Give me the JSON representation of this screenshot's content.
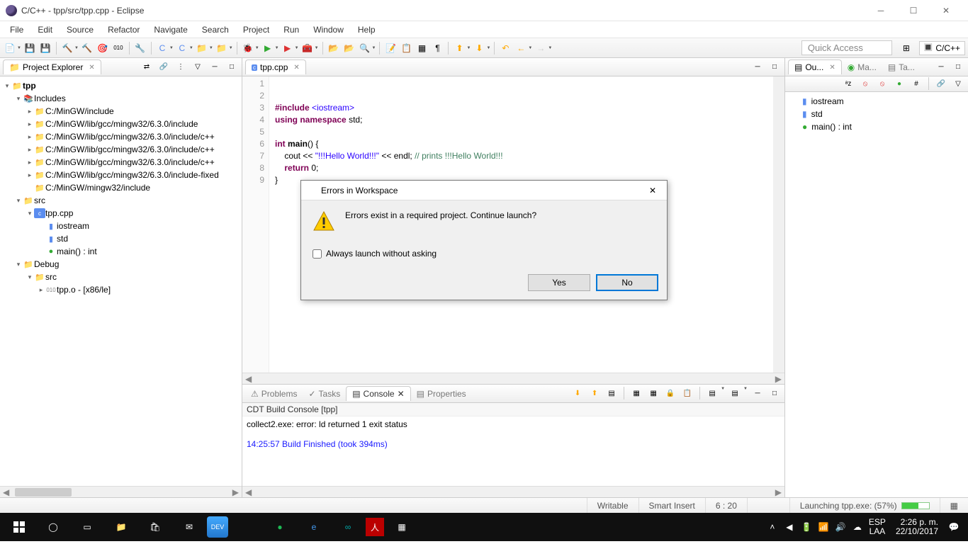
{
  "window": {
    "title": "C/C++ - tpp/src/tpp.cpp - Eclipse"
  },
  "menubar": [
    "File",
    "Edit",
    "Source",
    "Refactor",
    "Navigate",
    "Search",
    "Project",
    "Run",
    "Window",
    "Help"
  ],
  "quick_access": "Quick Access",
  "perspective": {
    "label": "C/C++"
  },
  "project_explorer": {
    "title": "Project Explorer",
    "tree": {
      "project": "tpp",
      "includes": "Includes",
      "include_paths": [
        "C:/MinGW/include",
        "C:/MinGW/lib/gcc/mingw32/6.3.0/include",
        "C:/MinGW/lib/gcc/mingw32/6.3.0/include/c++",
        "C:/MinGW/lib/gcc/mingw32/6.3.0/include/c++",
        "C:/MinGW/lib/gcc/mingw32/6.3.0/include/c++",
        "C:/MinGW/lib/gcc/mingw32/6.3.0/include-fixed",
        "C:/MinGW/mingw32/include"
      ],
      "src": "src",
      "src_file": "tpp.cpp",
      "src_children": [
        "iostream",
        "std",
        "main() : int"
      ],
      "debug": "Debug",
      "debug_src": "src",
      "debug_file": "tpp.o - [x86/le]"
    }
  },
  "editor": {
    "tab": "tpp.cpp",
    "lines": [
      "1",
      "2",
      "3",
      "4",
      "5",
      "6",
      "7",
      "8",
      "9"
    ],
    "code": {
      "l2_inc": "#include ",
      "l2_hdr": "<iostream>",
      "l3_a": "using ",
      "l3_b": "namespace ",
      "l3_c": "std;",
      "l5_a": "int ",
      "l5_b": "main",
      "l5_c": "() {",
      "l6_a": "    cout << ",
      "l6_b": "\"!!!Hello World!!!\"",
      "l6_c": " << endl; ",
      "l6_d": "// prints !!!Hello World!!!",
      "l7_a": "    ",
      "l7_b": "return ",
      "l7_c": "0;",
      "l8": "}"
    }
  },
  "bottom": {
    "tabs": [
      "Problems",
      "Tasks",
      "Console",
      "Properties"
    ],
    "console_title": "CDT Build Console [tpp]",
    "console_err": "collect2.exe: error: ld returned 1 exit status",
    "console_info": "14:25:57 Build Finished (took 394ms)"
  },
  "outline": {
    "tabs": [
      "Ou...",
      "Ma...",
      "Ta..."
    ],
    "items": [
      "iostream",
      "std",
      "main() : int"
    ]
  },
  "statusbar": {
    "writable": "Writable",
    "insert": "Smart Insert",
    "pos": "6 : 20",
    "launch": "Launching tpp.exe: (57%)"
  },
  "dialog": {
    "title": "Errors in Workspace",
    "message": "Errors exist in a required project. Continue launch?",
    "checkbox": "Always launch without asking",
    "yes": "Yes",
    "no": "No"
  },
  "taskbar": {
    "lang": "ESP",
    "kbd": "LAA",
    "time": "2:26 p. m.",
    "date": "22/10/2017"
  }
}
